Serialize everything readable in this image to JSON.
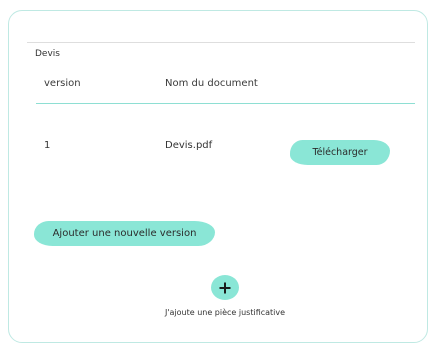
{
  "section": {
    "title": "Devis"
  },
  "table": {
    "headers": [
      "version",
      "Nom du document"
    ],
    "rows": [
      {
        "version": "1",
        "document": "Devis.pdf",
        "action_label": "Télécharger"
      }
    ]
  },
  "actions": {
    "add_version_label": "Ajouter une nouvelle version",
    "add_document_caption": "J'ajoute une pièce justificative",
    "add_document_icon": "plus-icon"
  },
  "colors": {
    "accent": "#8ae6d6",
    "card_border": "#bfe9e3",
    "header_rule": "#8edfd3"
  }
}
